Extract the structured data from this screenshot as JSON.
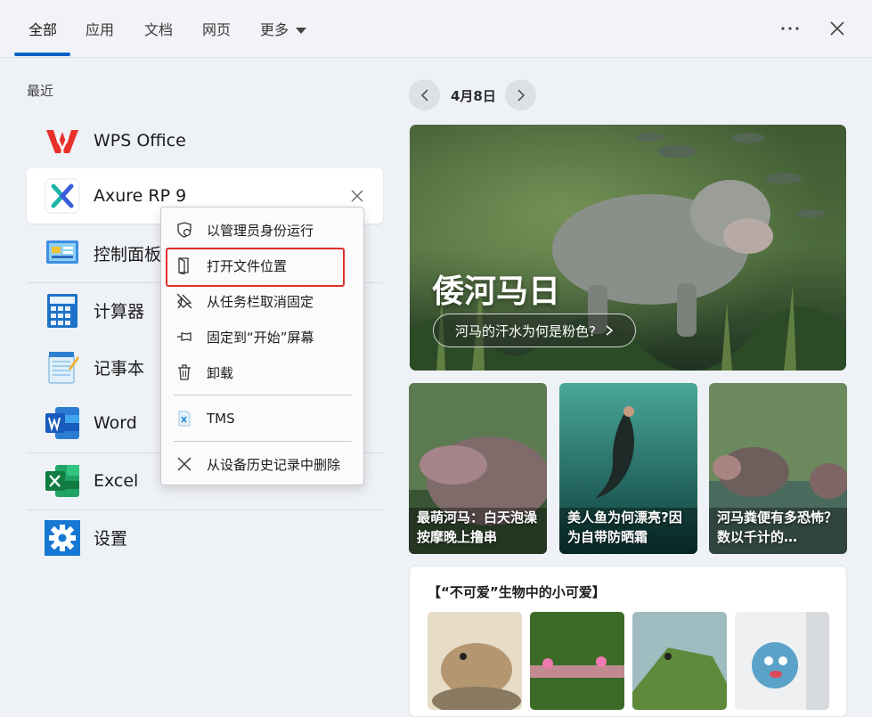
{
  "tabs": [
    {
      "label": "全部",
      "active": true
    },
    {
      "label": "应用"
    },
    {
      "label": "文档"
    },
    {
      "label": "网页"
    },
    {
      "label": "更多"
    }
  ],
  "topbar": {
    "more_icon": "ellipsis-icon",
    "close_icon": "close-icon"
  },
  "recent": {
    "label": "最近",
    "apps": [
      {
        "name": "WPS Office",
        "icon": "wps-icon"
      },
      {
        "name": "Axure RP 9",
        "icon": "axure-icon"
      },
      {
        "name": "控制面板",
        "icon": "control-panel-icon"
      },
      {
        "name": "计算器",
        "icon": "calculator-icon"
      },
      {
        "name": "记事本",
        "icon": "notepad-icon"
      },
      {
        "name": "Word",
        "icon": "word-icon"
      },
      {
        "name": "Excel",
        "icon": "excel-icon"
      },
      {
        "name": "设置",
        "icon": "settings-icon"
      }
    ]
  },
  "context_menu": {
    "items": [
      {
        "label": "以管理员身份运行",
        "icon": "shield-icon"
      },
      {
        "label": "打开文件位置",
        "icon": "folder-icon",
        "highlighted": true
      },
      {
        "label": "从任务栏取消固定",
        "icon": "unpin-icon"
      },
      {
        "label": "固定到“开始”屏幕",
        "icon": "pin-icon"
      },
      {
        "label": "卸载",
        "icon": "trash-icon"
      },
      {
        "label": "TMS",
        "icon": "file-icon"
      },
      {
        "label": "从设备历史记录中删除",
        "icon": "close-icon"
      }
    ]
  },
  "feed": {
    "date": "4月8日",
    "hero": {
      "title": "倭河马日",
      "link": "河马的汗水为何是粉色?"
    },
    "cards": [
      {
        "caption": "最萌河马：白天泡澡按摩晚上撸串"
      },
      {
        "caption": "美人鱼为何漂亮?因为自带防晒霜"
      },
      {
        "caption": "河马粪便有多恐怖？数以千计的…"
      }
    ],
    "panel": {
      "title": "【“不可爱”生物中的小可爱】"
    }
  },
  "colors": {
    "accent": "#0a63c9",
    "highlight": "#e0302c"
  }
}
